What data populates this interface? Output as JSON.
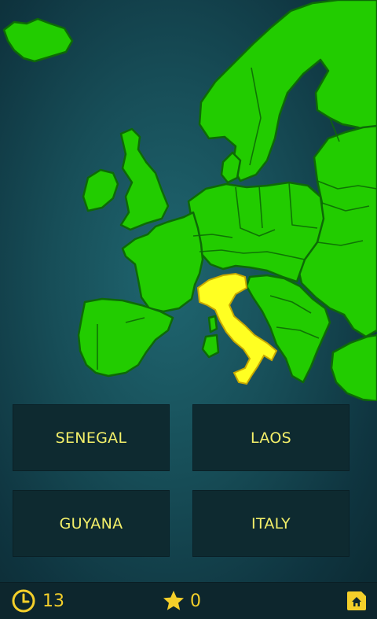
{
  "quiz": {
    "highlighted_country": "Italy",
    "answers": [
      "SENEGAL",
      "LAOS",
      "GUYANA",
      "ITALY"
    ]
  },
  "status": {
    "timer": "13",
    "stars": "0"
  },
  "icons": {
    "timer": "clock-icon",
    "stars": "star-icon",
    "home": "home-icon"
  },
  "colors": {
    "land": "#22cc00",
    "land_border": "#0d6a06",
    "highlight": "#ffff22",
    "answer_text": "#f4f06a",
    "status_text": "#f4cf2a"
  }
}
